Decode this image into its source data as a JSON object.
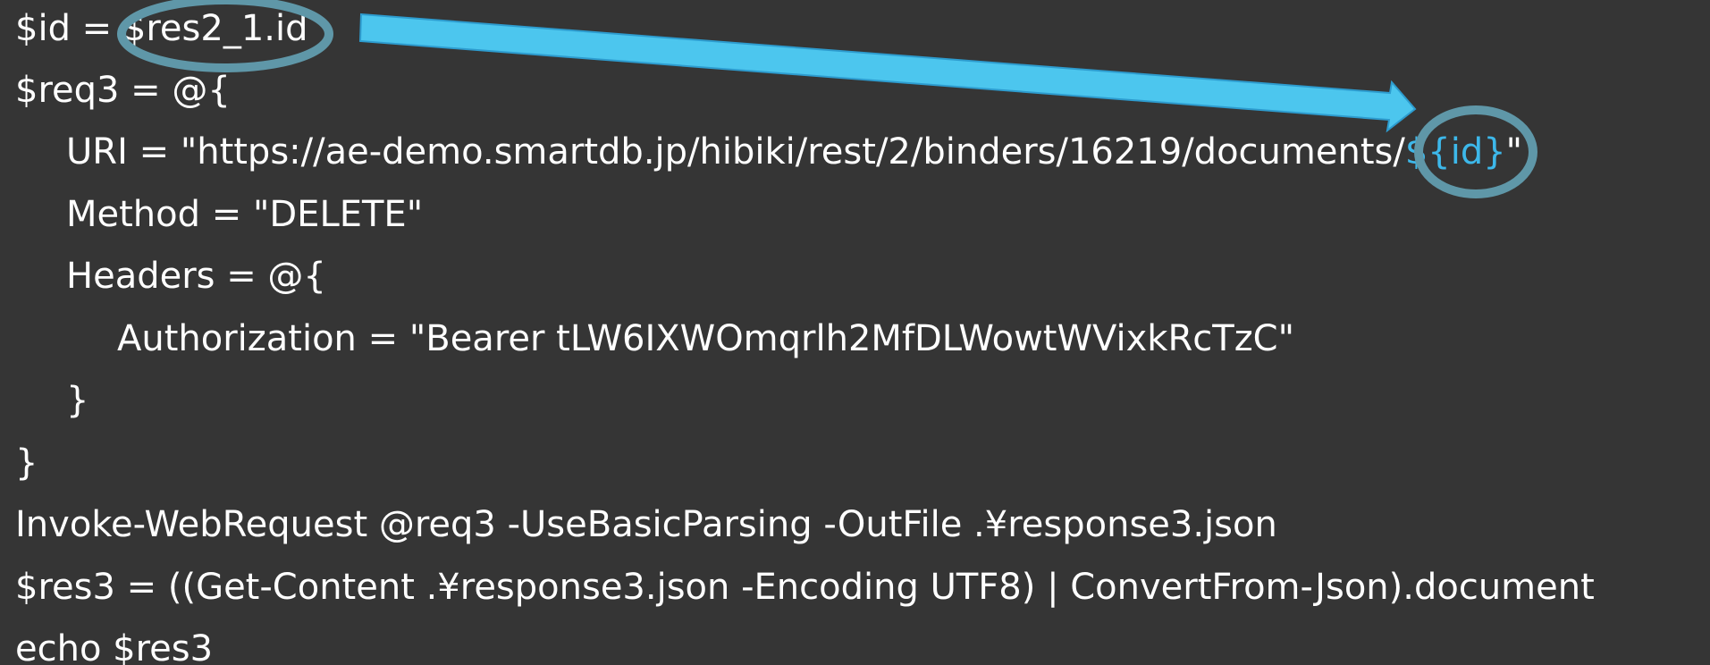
{
  "code": {
    "line1": "$id = $res2_1.id",
    "line2": "$req3 = @{",
    "line3_prefix": "URI = \"https://ae-demo.smartdb.jp/hibiki/rest/2/binders/16219/documents/",
    "line3_var": "${id}",
    "line3_suffix": "\"",
    "line4": "Method = \"DELETE\"",
    "line5": "Headers = @{",
    "line6": "Authorization = \"Bearer tLW6IXWOmqrlh2MfDLWowtWVixkRcTzC\"",
    "line7": "}",
    "line8": "}",
    "line9": "Invoke-WebRequest @req3 -UseBasicParsing -OutFile .¥response3.json",
    "line10": "$res3 = ((Get-Content .¥response3.json -Encoding UTF8) | ConvertFrom-Json).document",
    "line11": "echo $res3"
  },
  "colors": {
    "background": "#353535",
    "text": "#ffffff",
    "variable_highlight": "#3db8ea",
    "arrow_fill": "#4cc6ee",
    "circle_stroke": "#5f97a8"
  }
}
